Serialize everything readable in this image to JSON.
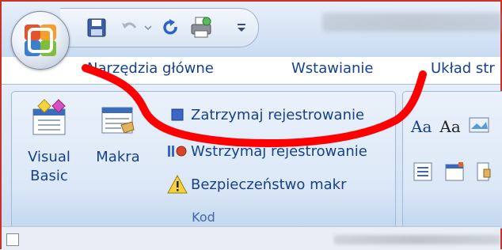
{
  "qat": {
    "items": [
      {
        "name": "save-icon"
      },
      {
        "name": "undo-icon"
      },
      {
        "name": "undo-dropdown-icon"
      },
      {
        "name": "redo-icon"
      },
      {
        "name": "print-preview-icon"
      },
      {
        "name": "customize-qat-icon"
      }
    ]
  },
  "tabs": [
    {
      "label": "Narzędzia główne"
    },
    {
      "label": "Wstawianie"
    },
    {
      "label": "Układ str"
    }
  ],
  "groups": {
    "kod": {
      "label": "Kod",
      "visual_basic_line1": "Visual",
      "visual_basic_line2": "Basic",
      "makra_label": "Makra",
      "record_label": "Zatrzymaj rejestrowanie",
      "pause_label": "Wstrzymaj rejestrowanie",
      "security_label": "Bezpieczeństwo makr"
    },
    "font_row": {
      "aa1": "Aa",
      "aa2": "Aa"
    }
  },
  "colors": {
    "accent": "#15428b",
    "scribble": "#ff0000",
    "frame": "#c9312b"
  }
}
